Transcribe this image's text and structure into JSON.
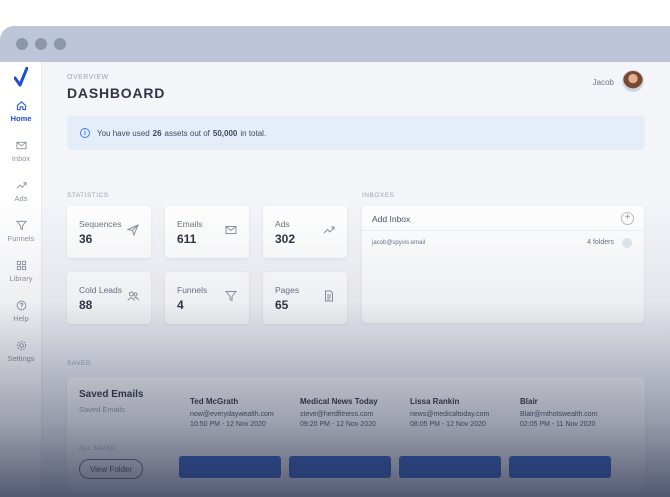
{
  "header": {
    "overview_label": "OVERVIEW",
    "page_title": "DASHBOARD",
    "user_name": "Jacob"
  },
  "sidebar": {
    "items": [
      {
        "label": "Home",
        "icon": "home-icon",
        "active": true
      },
      {
        "label": "Inbox",
        "icon": "mail-icon",
        "active": false
      },
      {
        "label": "Ads",
        "icon": "trend-icon",
        "active": false
      },
      {
        "label": "Funnels",
        "icon": "funnel-icon",
        "active": false
      },
      {
        "label": "Library",
        "icon": "grid-icon",
        "active": false
      },
      {
        "label": "Help",
        "icon": "help-icon",
        "active": false
      },
      {
        "label": "Settings",
        "icon": "gear-icon",
        "active": false
      }
    ]
  },
  "banner": {
    "prefix": "You have used",
    "used": "26",
    "middle": "assets out of",
    "total": "50,000",
    "suffix": "in total."
  },
  "statistics": {
    "section_label": "STATISTICS",
    "cards": [
      {
        "label": "Sequences",
        "value": "36",
        "icon": "send-icon"
      },
      {
        "label": "Emails",
        "value": "611",
        "icon": "mail-icon"
      },
      {
        "label": "Ads",
        "value": "302",
        "icon": "trend-icon"
      },
      {
        "label": "Cold Leads",
        "value": "88",
        "icon": "users-icon"
      },
      {
        "label": "Funnels",
        "value": "4",
        "icon": "funnel-icon"
      },
      {
        "label": "Pages",
        "value": "65",
        "icon": "document-icon"
      }
    ]
  },
  "inboxes": {
    "section_label": "INBOXES",
    "add_label": "Add Inbox",
    "rows": [
      {
        "email": "jacob@spyvis.email",
        "folders": "4 folders"
      }
    ]
  },
  "saved": {
    "section_label": "SAVED",
    "title": "Saved Emails",
    "subtitle": "Saved Emails",
    "all_label": "ALL SAVED",
    "view_button": "View Folder",
    "contacts": [
      {
        "name": "Ted McGrath",
        "email": "now@everydaywealth.com",
        "date": "10:50 PM - 12 Nov 2020"
      },
      {
        "name": "Medical News Today",
        "email": "steve@herdfitness.com",
        "date": "09:20 PM - 12 Nov 2020"
      },
      {
        "name": "Lissa Rankin",
        "email": "news@medicaltoday.com",
        "date": "08:05 PM - 12 Nov 2020"
      },
      {
        "name": "Blair",
        "email": "Blair@mthotswealth.com",
        "date": "02:05 PM - 11 Nov 2020"
      }
    ]
  },
  "colors": {
    "accent": "#1d4ed8",
    "banner_bg": "#e4edf8",
    "button_blue": "#2f63c8"
  }
}
